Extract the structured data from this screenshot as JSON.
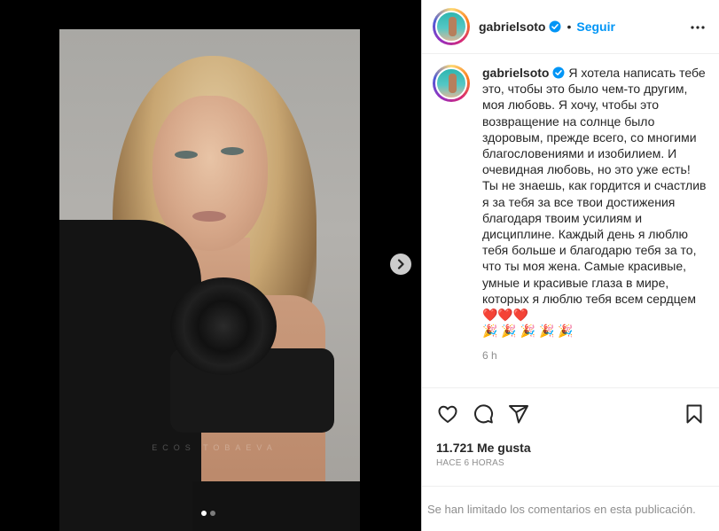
{
  "post": {
    "username": "gabrielsoto",
    "follow_label": "Seguir",
    "separator": "•",
    "caption_user": "gabrielsoto",
    "caption": "Я хотела написать тебе это, чтобы это было чем-то другим, моя любовь. Я хочу, чтобы это возвращение на солнце было здоровым, прежде всего, со многими благословениями и изобилием. И очевидная любовь, но это уже есть!\nТы не знаешь, как гордится и счастлив я за тебя за все твои достижения благодаря твоим усилиям и дисциплине. Каждый день я люблю тебя больше и благодарю тебя за то, что ты моя жена. Самые красивые, умные и красивые глаза в мире, которых я люблю тебя всем сердцем ❤️❤️❤️\n🎉 🎉 🎉 🎉 🎉",
    "caption_time": "6 h",
    "likes": "11.721 Me gusta",
    "posted_ago": "HACE 6 HORAS",
    "comments_notice": "Se han limitado los comentarios en esta publicación."
  },
  "media": {
    "watermark": "ECOS TOBAEVA",
    "carousel_total": 2,
    "carousel_active": 1
  },
  "icons": {
    "verified": "verified-badge-icon",
    "more": "more-options-icon",
    "like": "heart-icon",
    "comment": "comment-icon",
    "share": "send-icon",
    "save": "bookmark-icon",
    "next": "chevron-right-icon"
  },
  "colors": {
    "accent": "#0095f6",
    "text": "#262626",
    "muted": "#8e8e8e",
    "media_bg": "#000000"
  }
}
